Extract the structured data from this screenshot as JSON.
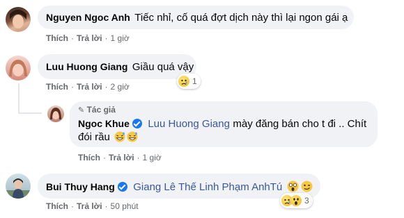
{
  "comments": [
    {
      "author": "Nguyen Ngoc Anh",
      "text": "Tiếc nhỉ, cố quá đợt dịch này thì lại ngon gái ạ",
      "like": "Thích",
      "reply": "Trả lời",
      "time": "1 giờ"
    },
    {
      "author": "Luu Huong Giang",
      "text": "Giầu quá vậy",
      "like": "Thích",
      "reply": "Trả lời",
      "time": "2 giờ",
      "reactions": {
        "icons": [
          "sad-emoji"
        ],
        "count": "1"
      },
      "reply_thread": {
        "author_badge": "Tác giả",
        "author": "Ngoc Khue",
        "mention": "Luu Huong Giang",
        "text_line1": "mày đăng bán cho t đi .. Chít",
        "text_line2": "đói rầu",
        "emoji_line": "😅😅",
        "like": "Thích",
        "reply": "Trả lời",
        "time": "1 giờ"
      }
    },
    {
      "author": "Bui Thuy Hang",
      "mentions": "Giang Lê Thế Linh Phạm AnhTú",
      "emoji_line": "😱😉",
      "like": "Thích",
      "reply": "Trả lời",
      "time": "50 phút",
      "reactions": {
        "icons": [
          "sad-emoji",
          "wow-emoji"
        ],
        "count": "3"
      }
    }
  ],
  "separator": "·"
}
